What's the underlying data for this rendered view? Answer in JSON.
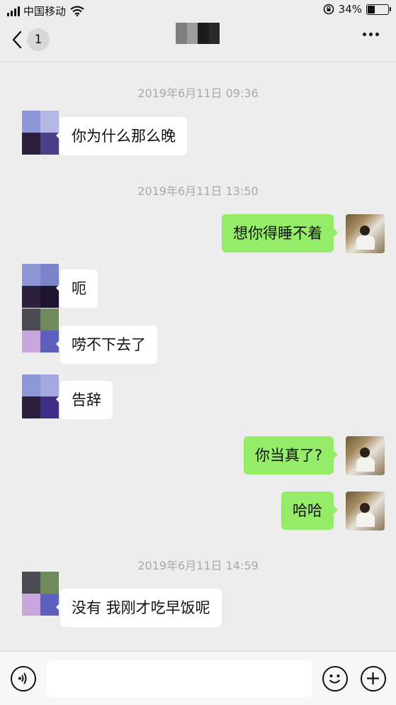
{
  "status_bar": {
    "carrier": "中国移动",
    "battery_text": "34%",
    "battery_level": 0.34,
    "icons": [
      "signal-icon",
      "wifi-icon",
      "orientation-lock-icon",
      "battery-icon"
    ]
  },
  "nav": {
    "back_icon": "chevron-left-icon",
    "unread_count": "1",
    "more_icon": "more-dots-icon"
  },
  "messages": [
    {
      "type": "time",
      "text": "2019年6月11日 09:36"
    },
    {
      "type": "in",
      "text": "你为什么那么晚"
    },
    {
      "type": "time",
      "text": "2019年6月11日 13:50"
    },
    {
      "type": "out",
      "text": "想你得睡不着"
    },
    {
      "type": "in",
      "text": "呃"
    },
    {
      "type": "in",
      "text": "唠不下去了"
    },
    {
      "type": "in",
      "text": "告辞"
    },
    {
      "type": "out",
      "text": "你当真了?"
    },
    {
      "type": "out",
      "text": "哈哈"
    },
    {
      "type": "time",
      "text": "2019年6月11日 14:59"
    },
    {
      "type": "in",
      "text": "没有 我刚才吃早饭呢"
    }
  ],
  "input_bar": {
    "voice_icon": "voice-icon",
    "emoji_icon": "emoji-icon",
    "plus_icon": "plus-icon",
    "input_value": ""
  },
  "colors": {
    "background": "#ededed",
    "outgoing_bubble": "#95ec69",
    "incoming_bubble": "#ffffff"
  }
}
